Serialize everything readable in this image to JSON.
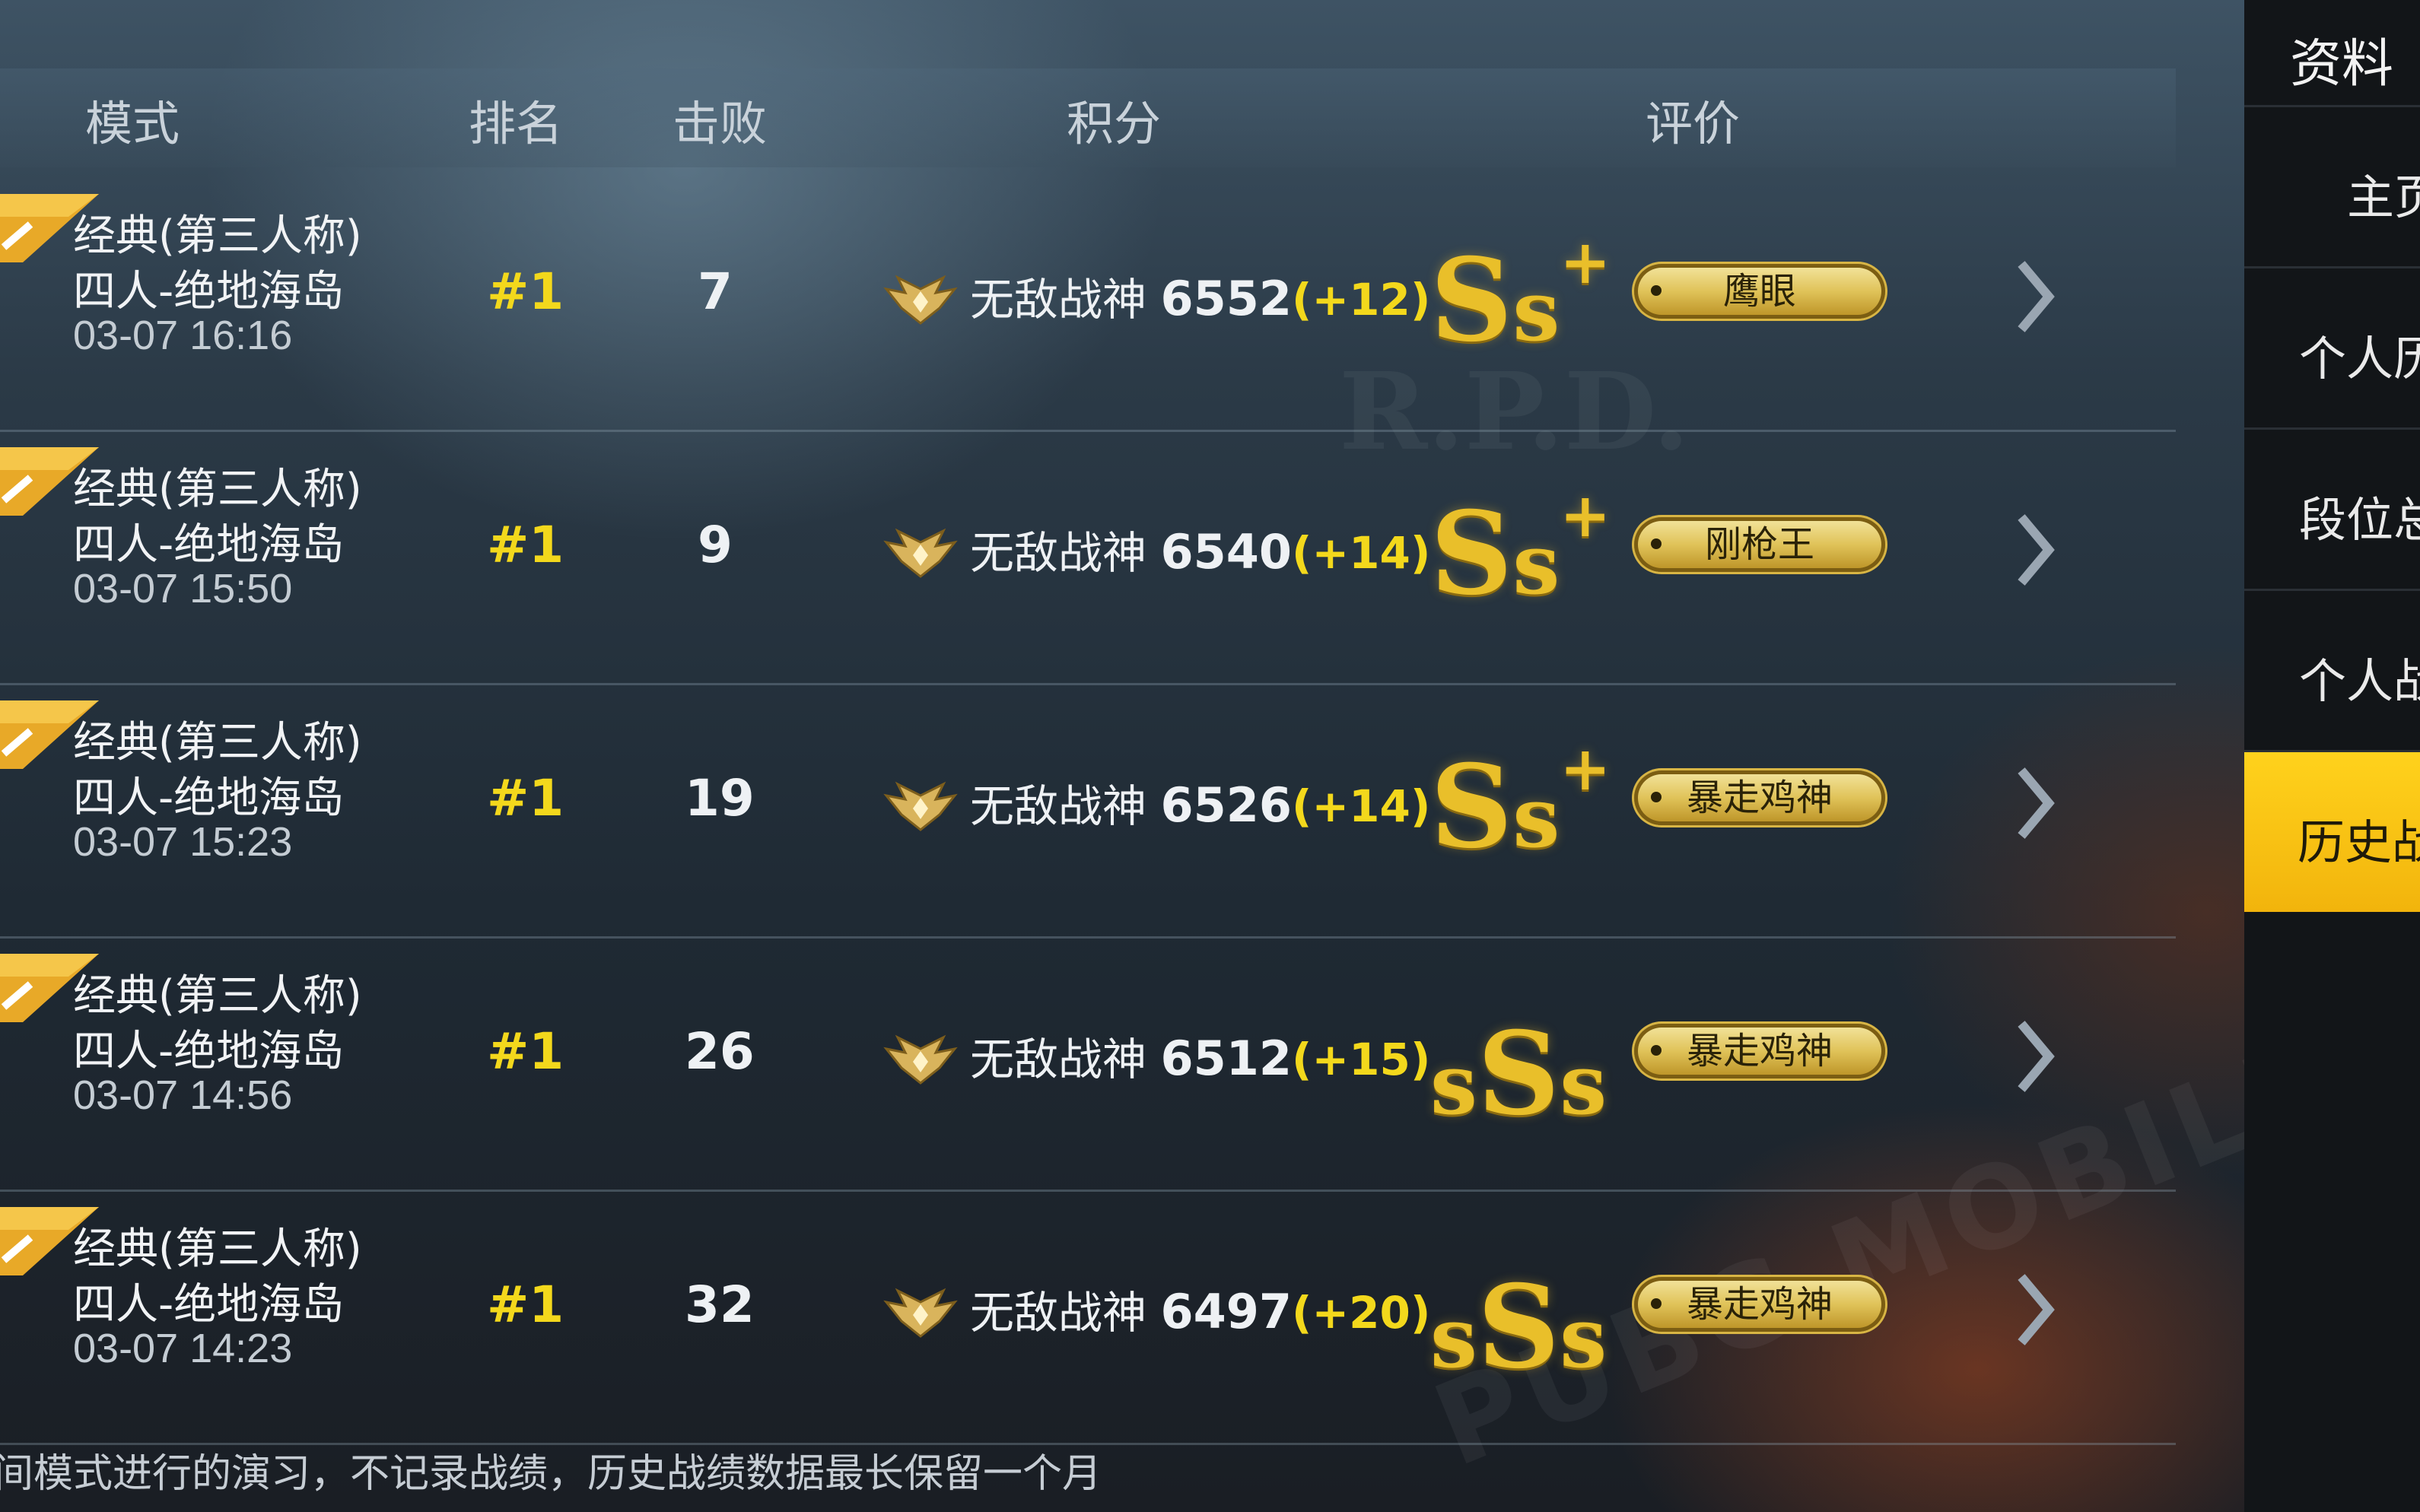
{
  "header": {
    "mode": "模式",
    "rank": "排名",
    "kills": "击败",
    "score": "积分",
    "rating": "评价"
  },
  "rows": [
    {
      "mode_line1": "经典(第三人称)",
      "mode_line2": "四人-绝地海岛",
      "time": "03-07 16:16",
      "rank": "#1",
      "kills": "7",
      "tier": "无敌战神",
      "score": "6552",
      "delta": "(+12)",
      "grade": "Ss+",
      "title_badge": "鹰眼"
    },
    {
      "mode_line1": "经典(第三人称)",
      "mode_line2": "四人-绝地海岛",
      "time": "03-07 15:50",
      "rank": "#1",
      "kills": "9",
      "tier": "无敌战神",
      "score": "6540",
      "delta": "(+14)",
      "grade": "Ss+",
      "title_badge": "刚枪王"
    },
    {
      "mode_line1": "经典(第三人称)",
      "mode_line2": "四人-绝地海岛",
      "time": "03-07 15:23",
      "rank": "#1",
      "kills": "19",
      "tier": "无敌战神",
      "score": "6526",
      "delta": "(+14)",
      "grade": "Ss+",
      "title_badge": "暴走鸡神"
    },
    {
      "mode_line1": "经典(第三人称)",
      "mode_line2": "四人-绝地海岛",
      "time": "03-07 14:56",
      "rank": "#1",
      "kills": "26",
      "tier": "无敌战神",
      "score": "6512",
      "delta": "(+15)",
      "grade": "sSs",
      "title_badge": "暴走鸡神"
    },
    {
      "mode_line1": "经典(第三人称)",
      "mode_line2": "四人-绝地海岛",
      "time": "03-07 14:23",
      "rank": "#1",
      "kills": "32",
      "tier": "无敌战神",
      "score": "6497",
      "delta": "(+20)",
      "grade": "sSs",
      "title_badge": "暴走鸡神"
    }
  ],
  "footer_note": "房间模式进行的演习，不记录战绩，历史战绩数据最长保留一个月",
  "sidebar": {
    "title": "资料",
    "items": [
      {
        "label": "主页"
      },
      {
        "label": "个人历"
      },
      {
        "label": "段位总"
      },
      {
        "label": "个人战"
      },
      {
        "label": "历史战",
        "active": true
      }
    ]
  },
  "background_watermarks": [
    "R.P.D.",
    "PLAYERUNKNOWN'S BATTLEGROUNDS MOBILE"
  ],
  "colors": {
    "accent_yellow": "#f3d81c",
    "active_tab": "#f7c314",
    "grade_gold": "#e9bf2a"
  }
}
